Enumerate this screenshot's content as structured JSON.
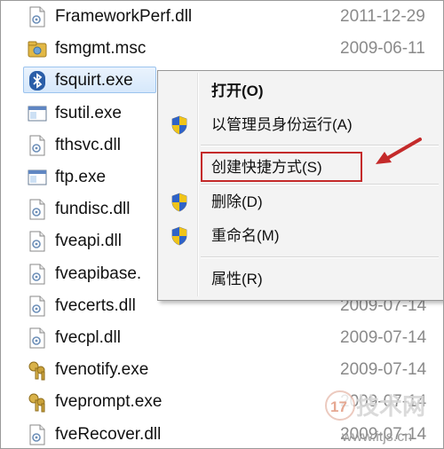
{
  "files": [
    {
      "name": "FrameworkPerf.dll",
      "date": "2011-12-29",
      "icon": "dll-icon",
      "selected": false
    },
    {
      "name": "fsmgmt.msc",
      "date": "2009-06-11",
      "icon": "msc-icon",
      "selected": false
    },
    {
      "name": "fsquirt.exe",
      "date": "",
      "icon": "bluetooth-icon",
      "selected": true
    },
    {
      "name": "fsutil.exe",
      "date": "",
      "icon": "exe-window-icon",
      "selected": false
    },
    {
      "name": "fthsvc.dll",
      "date": "",
      "icon": "dll-icon",
      "selected": false
    },
    {
      "name": "ftp.exe",
      "date": "",
      "icon": "exe-window-icon",
      "selected": false
    },
    {
      "name": "fundisc.dll",
      "date": "",
      "icon": "dll-icon",
      "selected": false
    },
    {
      "name": "fveapi.dll",
      "date": "",
      "icon": "dll-icon",
      "selected": false
    },
    {
      "name": "fveapibase.",
      "date": "",
      "icon": "dll-icon",
      "selected": false
    },
    {
      "name": "fvecerts.dll",
      "date": "2009-07-14",
      "icon": "dll-icon",
      "selected": false
    },
    {
      "name": "fvecpl.dll",
      "date": "2009-07-14",
      "icon": "dll-icon",
      "selected": false
    },
    {
      "name": "fvenotify.exe",
      "date": "2009-07-14",
      "icon": "keys-icon",
      "selected": false
    },
    {
      "name": "fveprompt.exe",
      "date": "2009-07-14",
      "icon": "keys-icon",
      "selected": false
    },
    {
      "name": "fveRecover.dll",
      "date": "2009-07-14",
      "icon": "dll-icon",
      "selected": false
    }
  ],
  "context_menu": {
    "open": "打开(O)",
    "run_as_admin": "以管理员身份运行(A)",
    "create_shortcut": "创建快捷方式(S)",
    "delete": "删除(D)",
    "rename": "重命名(M)",
    "properties": "属性(R)"
  },
  "watermark": {
    "logo_text": "17",
    "site_name": "技术网",
    "url": "www.itjs.cn"
  },
  "colors": {
    "highlight_border": "#c42a2a",
    "arrow": "#c42a2a",
    "selection_bg": "#d6e8fb",
    "date_text": "#8a8a8a"
  }
}
